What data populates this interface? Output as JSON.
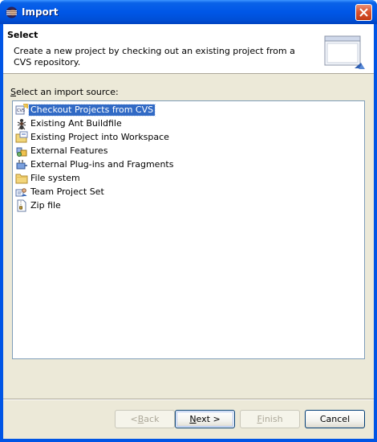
{
  "window": {
    "title": "Import",
    "icons": {
      "app": "eclipse-icon",
      "close": "close-icon"
    }
  },
  "banner": {
    "title": "Select",
    "description": "Create a new project by checking out an existing project from a CVS repository.",
    "image_icon": "wizard-banner-icon"
  },
  "source_section": {
    "label_prefix": "S",
    "label_rest": "elect an import source:",
    "items": [
      {
        "label": "Checkout Projects from CVS",
        "icon": "cvs-checkout-icon",
        "selected": true
      },
      {
        "label": "Existing Ant Buildfile",
        "icon": "ant-icon",
        "selected": false
      },
      {
        "label": "Existing Project into Workspace",
        "icon": "project-import-icon",
        "selected": false
      },
      {
        "label": "External Features",
        "icon": "feature-icon",
        "selected": false
      },
      {
        "label": "External Plug-ins and Fragments",
        "icon": "plugin-icon",
        "selected": false
      },
      {
        "label": "File system",
        "icon": "folder-icon",
        "selected": false
      },
      {
        "label": "Team Project Set",
        "icon": "team-icon",
        "selected": false
      },
      {
        "label": "Zip file",
        "icon": "zip-icon",
        "selected": false
      }
    ]
  },
  "buttons": {
    "back": {
      "pre": "< ",
      "mnemonic": "B",
      "post": "ack",
      "enabled": false
    },
    "next": {
      "pre": "",
      "mnemonic": "N",
      "post": "ext >",
      "enabled": true
    },
    "finish": {
      "pre": "",
      "mnemonic": "F",
      "post": "inish",
      "enabled": false
    },
    "cancel": {
      "label": "Cancel",
      "enabled": true
    }
  },
  "colors": {
    "titlebar": "#0057e7",
    "dialog_bg": "#ece9d8",
    "selection": "#316ac5"
  }
}
